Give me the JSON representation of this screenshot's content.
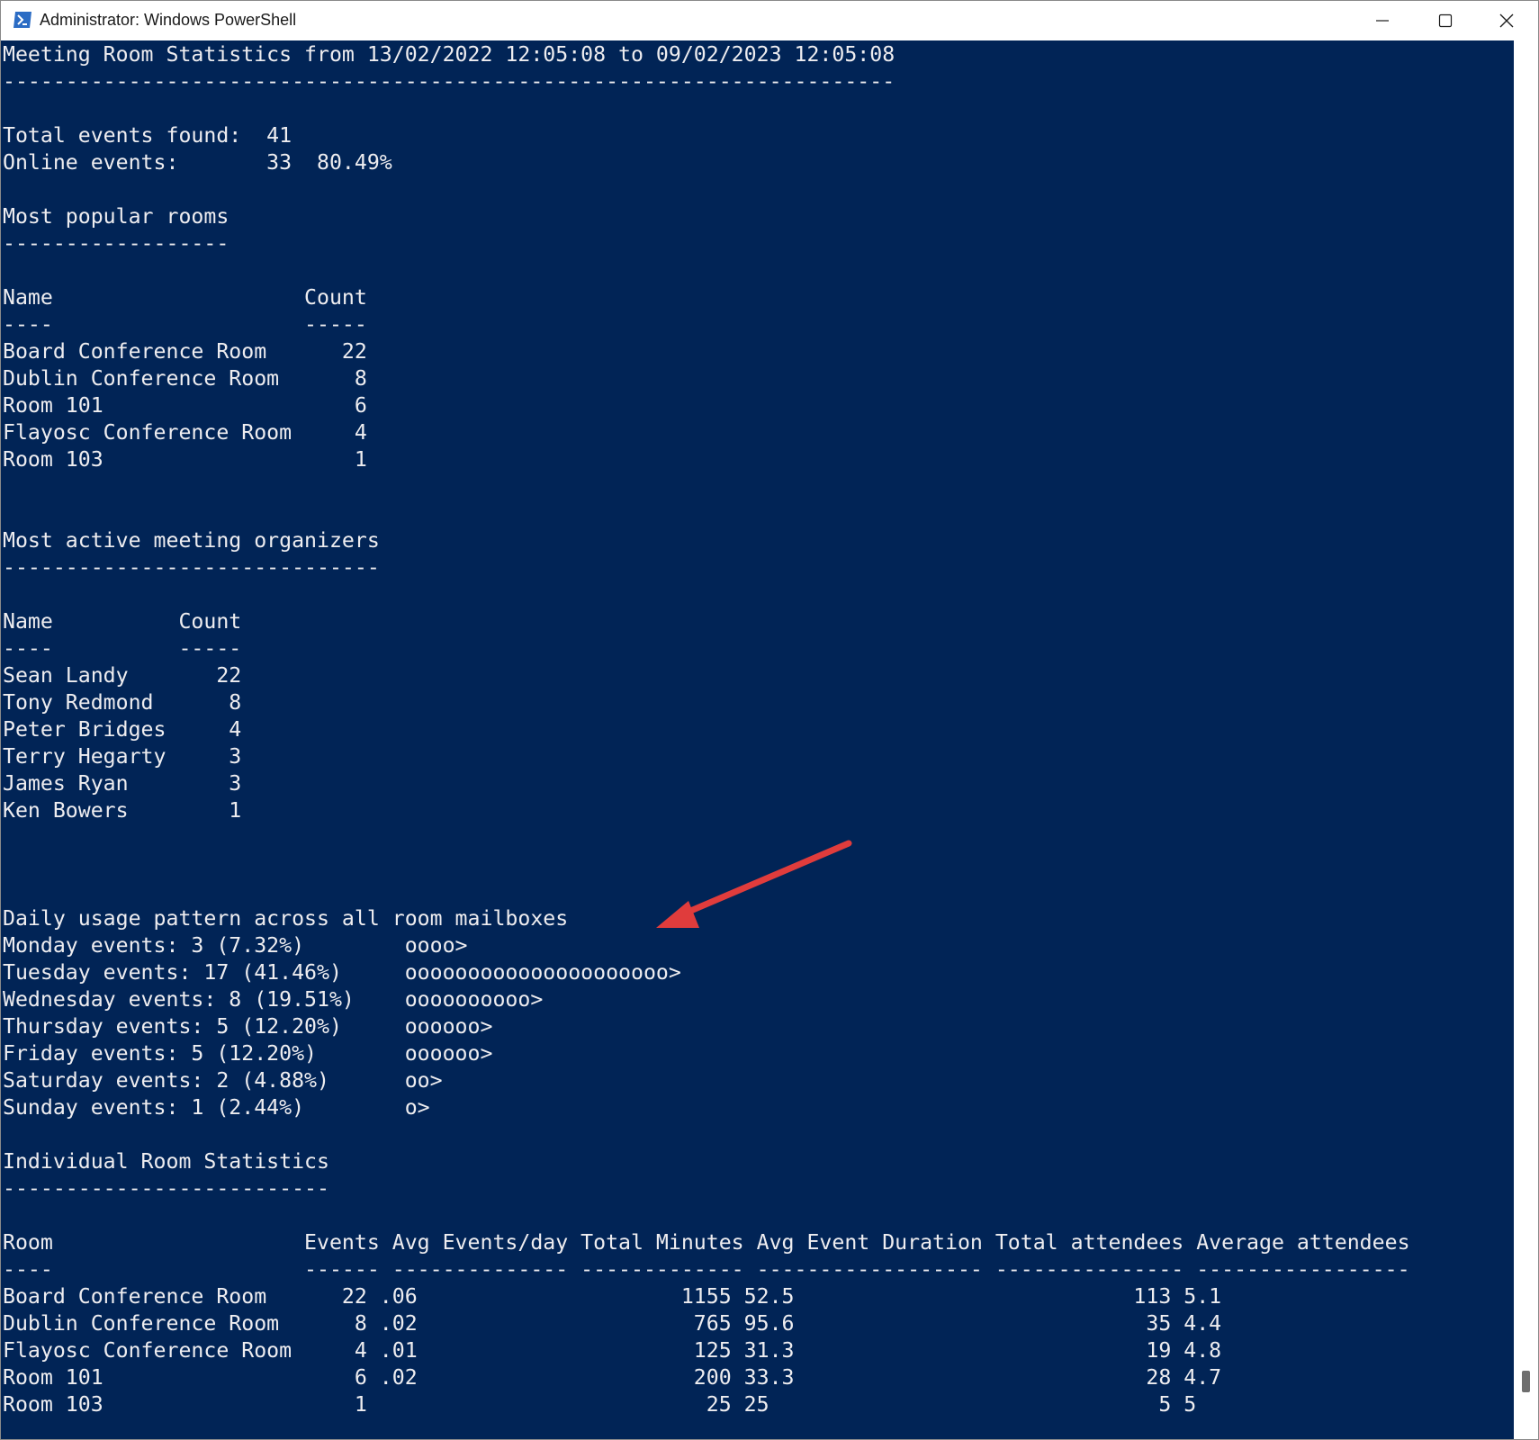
{
  "window": {
    "title": "Administrator: Windows PowerShell",
    "icon": "powershell-icon",
    "controls": [
      "minimize-icon",
      "maximize-icon",
      "close-icon"
    ]
  },
  "colors": {
    "console_background": "#012456",
    "console_foreground": "#eeedf0",
    "annotation_arrow": "#e03c3c"
  },
  "console": {
    "lines": [
      "Meeting Room Statistics from 13/02/2022 12:05:08 to 09/02/2023 12:05:08",
      "-----------------------------------------------------------------------",
      "",
      "Total events found:  41",
      "Online events:       33  80.49%",
      "",
      "Most popular rooms",
      "------------------",
      "",
      "Name                    Count",
      "----                    -----",
      "Board Conference Room      22",
      "Dublin Conference Room      8",
      "Room 101                    6",
      "Flayosc Conference Room     4",
      "Room 103                    1",
      "",
      "",
      "Most active meeting organizers",
      "------------------------------",
      "",
      "Name          Count",
      "----          -----",
      "Sean Landy       22",
      "Tony Redmond      8",
      "Peter Bridges     4",
      "Terry Hegarty     3",
      "James Ryan        3",
      "Ken Bowers        1",
      "",
      "",
      "",
      "Daily usage pattern across all room mailboxes",
      "Monday events: 3 (7.32%)        oooo>",
      "Tuesday events: 17 (41.46%)     ooooooooooooooooooooo>",
      "Wednesday events: 8 (19.51%)    oooooooooo>",
      "Thursday events: 5 (12.20%)     oooooo>",
      "Friday events: 5 (12.20%)       oooooo>",
      "Saturday events: 2 (4.88%)      oo>",
      "Sunday events: 1 (2.44%)        o>",
      "",
      "Individual Room Statistics",
      "--------------------------",
      "",
      "Room                    Events Avg Events/day Total Minutes Avg Event Duration Total attendees Average attendees",
      "----                    ------ -------------- ------------- ------------------ --------------- -----------------",
      "Board Conference Room      22 .06                     1155 52.5                           113 5.1",
      "Dublin Conference Room      8 .02                      765 95.6                            35 4.4",
      "Flayosc Conference Room     4 .01                      125 31.3                            19 4.8",
      "Room 101                    6 .02                      200 33.3                            28 4.7",
      "Room 103                    1                           25 25                               5 5"
    ]
  },
  "annotation": {
    "icon": "red-arrow-icon"
  }
}
